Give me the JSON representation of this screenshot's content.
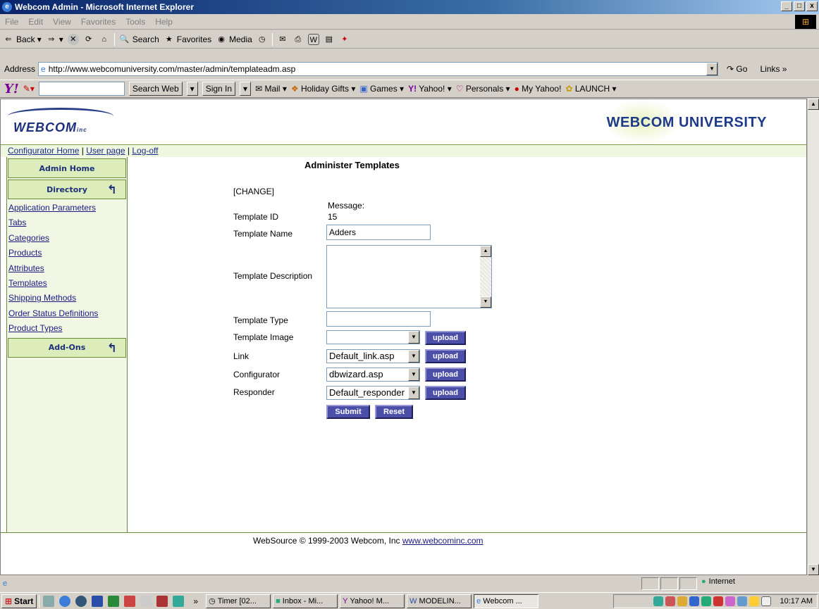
{
  "window": {
    "title": "Webcom Admin - Microsoft Internet Explorer",
    "min": "_",
    "max": "□",
    "close": "x"
  },
  "menu": [
    "File",
    "Edit",
    "View",
    "Favorites",
    "Tools",
    "Help"
  ],
  "toolbar": {
    "back": "Back",
    "search": "Search",
    "favorites": "Favorites",
    "media": "Media"
  },
  "address": {
    "label": "Address",
    "url": "http://www.webcomuniversity.com/master/admin/templateadm.asp",
    "go": "Go",
    "links": "Links »"
  },
  "yahoo": {
    "logo": "Y!",
    "search_btn": "Search Web",
    "sign_in": "Sign In",
    "items": [
      "Mail",
      "Holiday Gifts",
      "Games",
      "Yahoo!",
      "Personals",
      "My Yahoo!",
      "LAUNCH"
    ]
  },
  "site": {
    "logo_text": "WEBCOM",
    "logo_inc": "inc",
    "brand": "WEBCOM UNIVERSITY"
  },
  "topnav": {
    "home": "Configurator Home",
    "user": "User page",
    "logoff": "Log-off",
    "sep": " | "
  },
  "sidebar": {
    "admin_home": "Admin Home",
    "directory": "Directory",
    "links": [
      "Application Parameters",
      "Tabs",
      "Categories",
      "Products",
      "Attributes",
      "Templates",
      "Shipping Methods",
      "Order Status Definitions",
      "Product Types"
    ],
    "addons": "Add-Ons"
  },
  "form": {
    "title": "Administer Templates",
    "change": "[CHANGE]",
    "message_label": "Message:",
    "template_id_label": "Template ID",
    "template_id": "15",
    "name_label": "Template Name",
    "name_value": "Adders",
    "description_label": "Template Description",
    "description_value": "",
    "type_label": "Template Type",
    "type_value": "",
    "image_label": "Template Image",
    "image_value": "",
    "link_label": "Link",
    "link_value": "Default_link.asp",
    "configurator_label": "Configurator",
    "configurator_value": "dbwizard.asp",
    "responder_label": "Responder",
    "responder_value": "Default_responder",
    "upload": "upload",
    "submit": "Submit",
    "reset": "Reset"
  },
  "footer": {
    "text": "WebSource © 1999-2003 Webcom, Inc ",
    "link": "www.webcominc.com"
  },
  "status": {
    "zone": "Internet"
  },
  "taskbar": {
    "start": "Start",
    "tasks": [
      "Timer [02...",
      "Inbox - Mi...",
      "Yahoo! M...",
      "MODELIN...",
      "Webcom ..."
    ],
    "clock": "10:17 AM"
  }
}
